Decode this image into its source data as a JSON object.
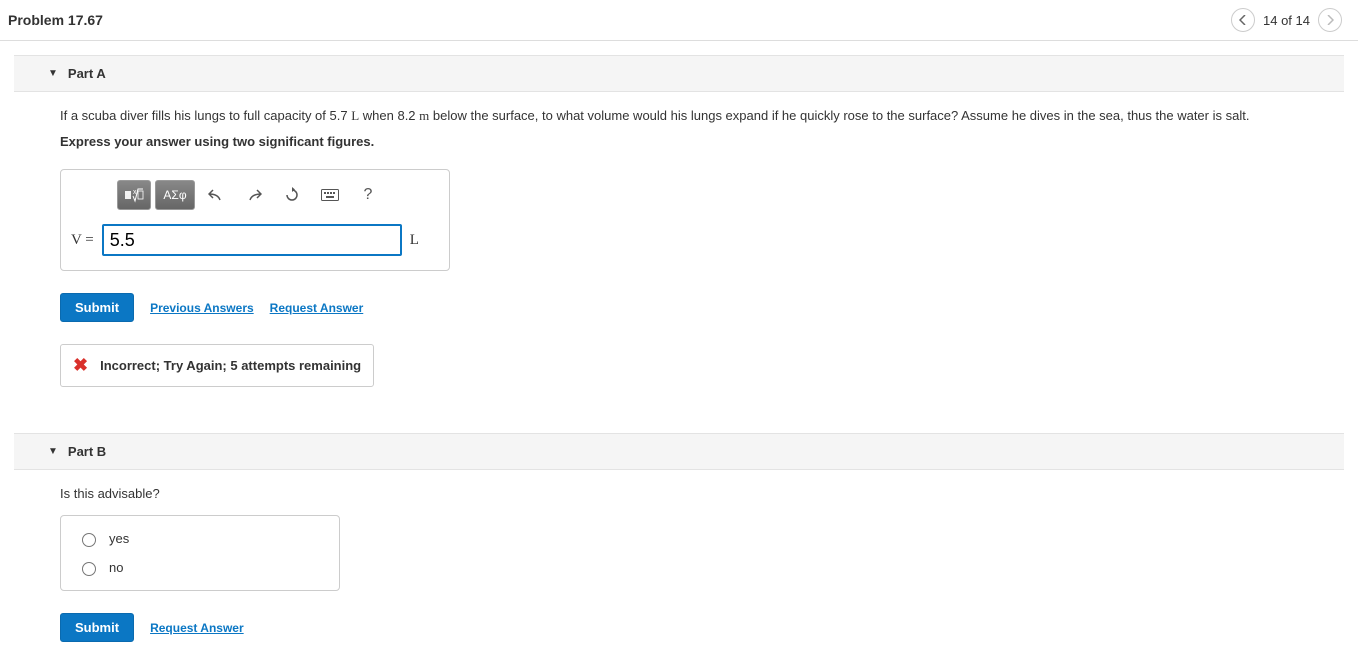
{
  "header": {
    "title": "Problem 17.67",
    "nav_count": "14 of 14"
  },
  "partA": {
    "title": "Part A",
    "question_pre": "If a scuba diver fills his lungs to full capacity of 5.7 ",
    "q_unit1": "L",
    "q_mid": " when 8.2 ",
    "q_unit2": "m",
    "q_post": " below the surface, to what volume would his lungs expand if he quickly rose to the surface? Assume he dives in the sea, thus the water is salt.",
    "instruction": "Express your answer using two significant figures.",
    "var_label": "V = ",
    "value": "5.5",
    "unit": "L",
    "toolbar": {
      "greek": "ΑΣφ",
      "help": "?"
    },
    "submit": "Submit",
    "prev_answers": "Previous Answers",
    "request_answer": "Request Answer",
    "feedback": "Incorrect; Try Again; 5 attempts remaining"
  },
  "partB": {
    "title": "Part B",
    "question": "Is this advisable?",
    "opt_yes": "yes",
    "opt_no": "no",
    "submit": "Submit",
    "request_answer": "Request Answer"
  }
}
